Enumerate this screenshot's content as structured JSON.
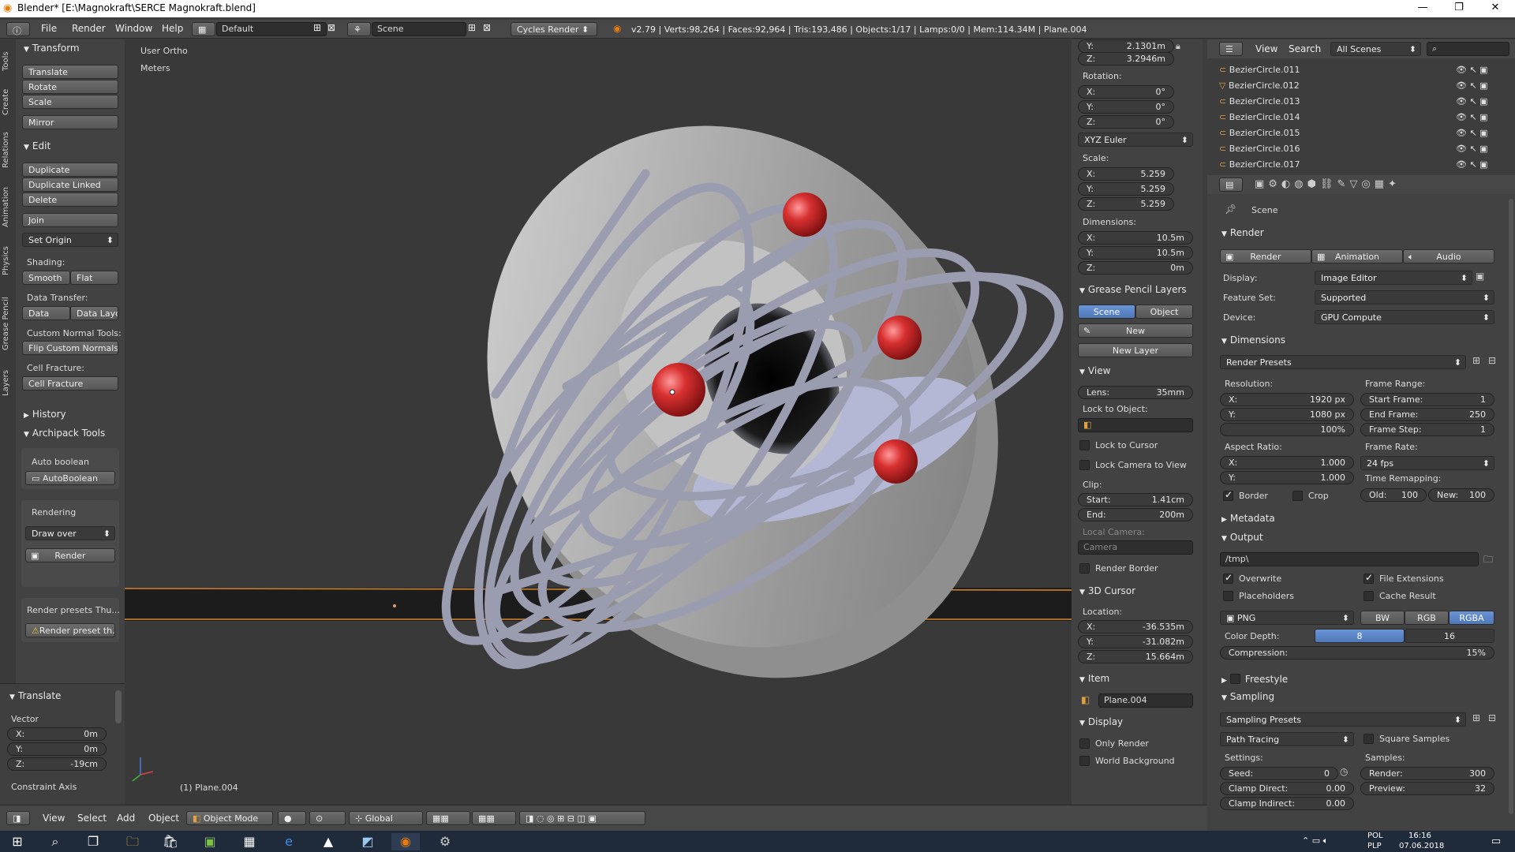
{
  "window": {
    "title": "Blender* [E:\\Magnokraft\\SERCE Magnokraft.blend]"
  },
  "infobar": {
    "menus": [
      "File",
      "Render",
      "Window",
      "Help"
    ],
    "layout": "Default",
    "scene": "Scene",
    "engine": "Cycles Render",
    "stats": "v2.79 | Verts:98,264 | Faces:92,964 | Tris:193,486 | Objects:1/17 | Lamps:0/0 | Mem:114.34M | Plane.004"
  },
  "toolshelf": {
    "tabs": [
      "Tools",
      "Create",
      "Relations",
      "Animation",
      "Physics",
      "Grease Pencil",
      "Layers"
    ],
    "transform": {
      "title": "Transform",
      "buttons": [
        "Translate",
        "Rotate",
        "Scale",
        "Mirror"
      ]
    },
    "edit": {
      "title": "Edit",
      "buttons": [
        "Duplicate",
        "Duplicate Linked",
        "Delete",
        "Join"
      ],
      "set_origin": "Set Origin",
      "shading_label": "Shading:",
      "smooth": "Smooth",
      "flat": "Flat",
      "data_transfer_label": "Data Transfer:",
      "data": "Data",
      "data_layo": "Data Layo",
      "custom_normal_label": "Custom Normal Tools:",
      "flip_normals": "Flip Custom Normals",
      "cell_fracture_label": "Cell Fracture:",
      "cell_fracture": "Cell Fracture"
    },
    "history": "History",
    "archipack": {
      "title": "Archipack Tools",
      "auto_boolean_label": "Auto boolean",
      "auto_boolean": "AutoBoolean",
      "rendering_label": "Rendering",
      "draw_over": "Draw over",
      "render": "Render",
      "render_presets_label": "Render presets Thu...",
      "render_preset_btn": "Render preset th..."
    },
    "operator": {
      "title": "Translate",
      "vector_label": "Vector",
      "x": "0m",
      "y": "0m",
      "z": "-19cm",
      "constraint": "Constraint Axis"
    }
  },
  "viewport": {
    "view_name": "User Ortho",
    "units": "Meters",
    "object_label": "(1) Plane.004"
  },
  "properties_panel": {
    "loc_y": "2.1301m",
    "loc_z": "3.2946m",
    "rotation_label": "Rotation:",
    "rot_x": "0°",
    "rot_y": "0°",
    "rot_z": "0°",
    "rotation_mode": "XYZ Euler",
    "scale_label": "Scale:",
    "scale_x": "5.259",
    "scale_y": "5.259",
    "scale_z": "5.259",
    "dimensions_label": "Dimensions:",
    "dim_x": "10.5m",
    "dim_y": "10.5m",
    "dim_z": "0m",
    "grease_pencil": "Grease Pencil Layers",
    "gp_scene": "Scene",
    "gp_object": "Object",
    "gp_new": "New",
    "gp_new_layer": "New Layer",
    "view_title": "View",
    "lens_label": "Lens:",
    "lens": "35mm",
    "lock_object": "Lock to Object:",
    "lock_cursor": "Lock to Cursor",
    "lock_camera": "Lock Camera to View",
    "clip_label": "Clip:",
    "clip_start_label": "Start:",
    "clip_start": "1.41cm",
    "clip_end_label": "End:",
    "clip_end": "200m",
    "local_camera": "Local Camera:",
    "camera": "Camera",
    "render_border": "Render Border",
    "cursor_title": "3D Cursor",
    "location_label": "Location:",
    "cur_x": "-36.535m",
    "cur_y": "-31.082m",
    "cur_z": "15.664m",
    "item_title": "Item",
    "item_name": "Plane.004",
    "display_title": "Display",
    "only_render": "Only Render",
    "world_background": "World Background"
  },
  "outliner": {
    "view": "View",
    "search": "Search",
    "scenes": "All Scenes",
    "items": [
      "BezierCircle.011",
      "BezierCircle.012",
      "BezierCircle.013",
      "BezierCircle.014",
      "BezierCircle.015",
      "BezierCircle.016",
      "BezierCircle.017"
    ]
  },
  "render_props": {
    "context": "Scene",
    "render_title": "Render",
    "render_btn": "Render",
    "animation_btn": "Animation",
    "audio_btn": "Audio",
    "display_label": "Display:",
    "display": "Image Editor",
    "feature_label": "Feature Set:",
    "feature": "Supported",
    "device_label": "Device:",
    "device": "GPU Compute",
    "dimensions_title": "Dimensions",
    "presets": "Render Presets",
    "resolution_label": "Resolution:",
    "res_x": "1920 px",
    "res_y": "1080 px",
    "res_pct": "100%",
    "frame_range_label": "Frame Range:",
    "start_frame_label": "Start Frame:",
    "start_frame": "1",
    "end_frame_label": "End Frame:",
    "end_frame": "250",
    "frame_step_label": "Frame Step:",
    "frame_step": "1",
    "aspect_label": "Aspect Ratio:",
    "aspect_x": "1.000",
    "aspect_y": "1.000",
    "frame_rate_label": "Frame Rate:",
    "frame_rate": "24 fps",
    "border": "Border",
    "crop": "Crop",
    "time_remap": "Time Remapping:",
    "old_label": "Old:",
    "old": "100",
    "new_label": "New:",
    "new": "100",
    "metadata_title": "Metadata",
    "output_title": "Output",
    "output_path": "/tmp\\",
    "overwrite": "Overwrite",
    "file_ext": "File Extensions",
    "placeholders": "Placeholders",
    "cache_result": "Cache Result",
    "format": "PNG",
    "bw": "BW",
    "rgb": "RGB",
    "rgba": "RGBA",
    "color_depth_label": "Color Depth:",
    "depth_8": "8",
    "depth_16": "16",
    "compression_label": "Compression:",
    "compression": "15%",
    "freestyle_title": "Freestyle",
    "sampling_title": "Sampling",
    "sampling_presets": "Sampling Presets",
    "integrator": "Path Tracing",
    "square_samples": "Square Samples",
    "settings_label": "Settings:",
    "samples_label": "Samples:",
    "seed_label": "Seed:",
    "seed": "0",
    "render_samples_label": "Render:",
    "render_samples": "300",
    "clamp_direct_label": "Clamp Direct:",
    "clamp_direct": "0.00",
    "preview_label": "Preview:",
    "preview": "32",
    "clamp_indirect_label": "Clamp Indirect:",
    "clamp_indirect": "0.00"
  },
  "view3d_header": {
    "menus": [
      "View",
      "Select",
      "Add",
      "Object"
    ],
    "mode": "Object Mode",
    "orientation": "Global"
  },
  "taskbar": {
    "lang": "POL",
    "lang2": "PLP",
    "time": "16:16",
    "date": "07.06.2018"
  }
}
